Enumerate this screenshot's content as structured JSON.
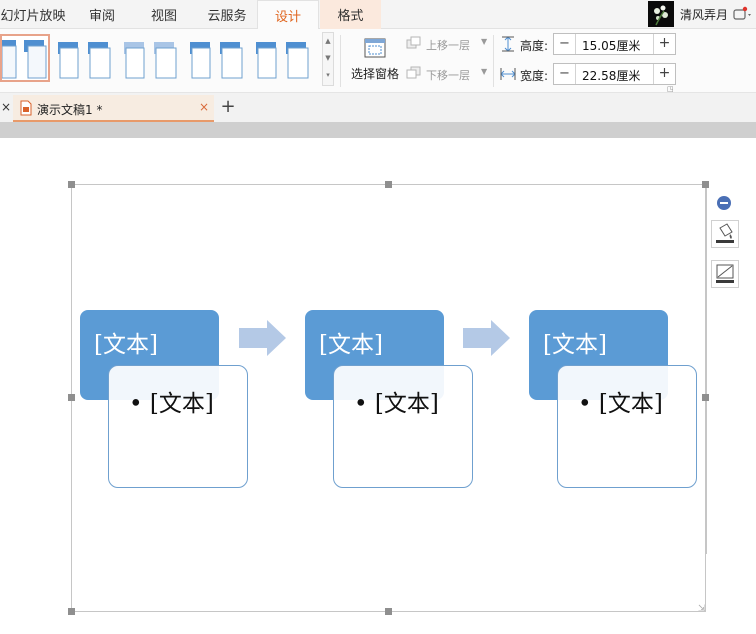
{
  "menu": {
    "tabs": [
      "幻灯片放映",
      "审阅",
      "视图",
      "云服务",
      "设计",
      "格式"
    ],
    "active_tab": "设计",
    "user_name": "清风弄月"
  },
  "ribbon": {
    "select_pane_label": "选择窗格",
    "bring_forward_label": "上移一层",
    "send_backward_label": "下移一层",
    "height_label": "高度:",
    "height_value": "15.05厘米",
    "width_label": "宽度:",
    "width_value": "22.58厘米",
    "minus": "−",
    "plus": "+"
  },
  "document": {
    "tab_name": "演示文稿1 *",
    "close_glyph": "×",
    "new_tab_glyph": "+"
  },
  "smartart": {
    "blocks": [
      {
        "title": "[文本]",
        "bullet": "• [文本]"
      },
      {
        "title": "[文本]",
        "bullet": "• [文本]"
      },
      {
        "title": "[文本]",
        "bullet": "• [文本]"
      }
    ]
  },
  "colors": {
    "accent": "#e0661f",
    "block_fill": "#5b9bd5",
    "block_border": "#6fa0cf",
    "arrow_fill": "#b4c9e6"
  }
}
